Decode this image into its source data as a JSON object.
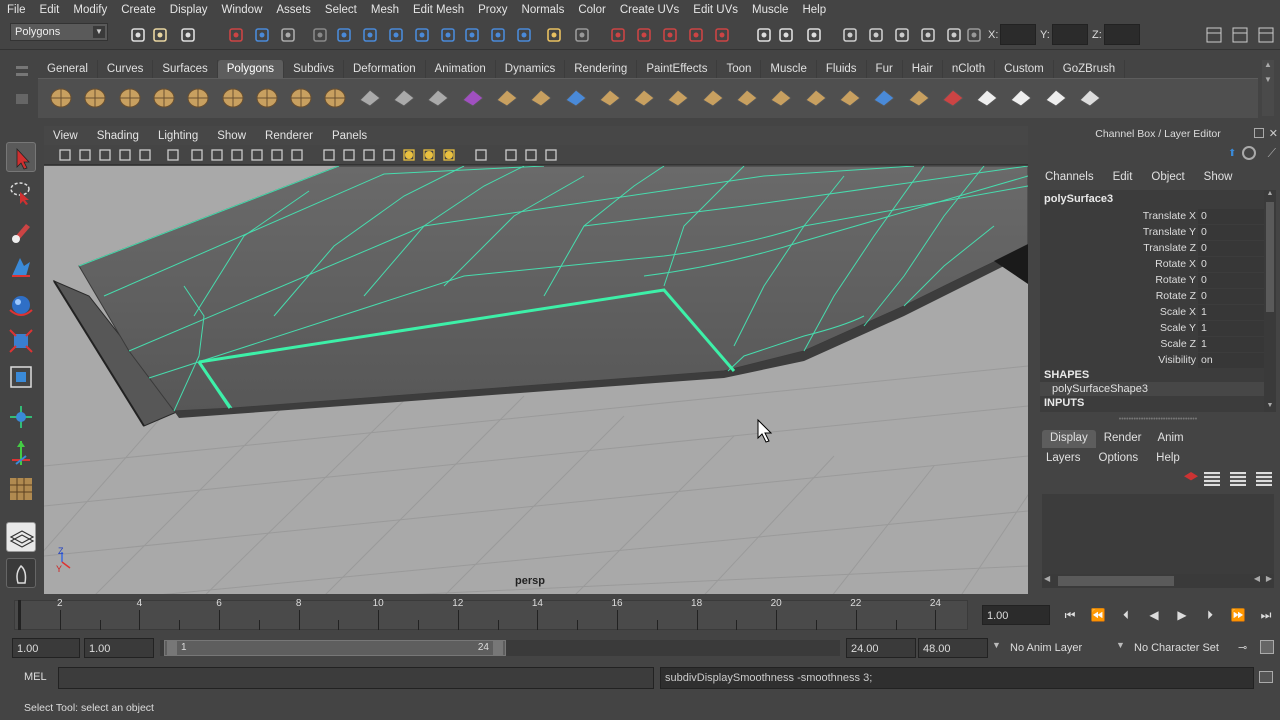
{
  "menubar": [
    "File",
    "Edit",
    "Modify",
    "Create",
    "Display",
    "Window",
    "Assets",
    "Select",
    "Mesh",
    "Edit Mesh",
    "Proxy",
    "Normals",
    "Color",
    "Create UVs",
    "Edit UVs",
    "Muscle",
    "Help"
  ],
  "status": {
    "mode_selector": "Polygons",
    "x_label": "X:",
    "y_label": "Y:",
    "z_label": "Z:"
  },
  "shelf_tabs": [
    "General",
    "Curves",
    "Surfaces",
    "Polygons",
    "Subdivs",
    "Deformation",
    "Animation",
    "Dynamics",
    "Rendering",
    "PaintEffects",
    "Toon",
    "Muscle",
    "Fluids",
    "Fur",
    "Hair",
    "nCloth",
    "Custom",
    "GoZBrush"
  ],
  "active_shelf_tab": "Polygons",
  "viewport": {
    "menus": [
      "View",
      "Shading",
      "Lighting",
      "Show",
      "Renderer",
      "Panels"
    ],
    "camera_label": "persp",
    "axis_y": "Y",
    "axis_z": "Z"
  },
  "channel_box": {
    "title": "Channel Box / Layer Editor",
    "menus": [
      "Channels",
      "Edit",
      "Object",
      "Show"
    ],
    "object_name": "polySurface3",
    "attributes": [
      {
        "name": "Translate X",
        "value": "0"
      },
      {
        "name": "Translate Y",
        "value": "0"
      },
      {
        "name": "Translate Z",
        "value": "0"
      },
      {
        "name": "Rotate X",
        "value": "0"
      },
      {
        "name": "Rotate Y",
        "value": "0"
      },
      {
        "name": "Rotate Z",
        "value": "0"
      },
      {
        "name": "Scale X",
        "value": "1"
      },
      {
        "name": "Scale Y",
        "value": "1"
      },
      {
        "name": "Scale Z",
        "value": "1"
      },
      {
        "name": "Visibility",
        "value": "on"
      }
    ],
    "shapes_header": "SHAPES",
    "shape_name": "polySurfaceShape3",
    "inputs_header": "INPUTS"
  },
  "layer_editor": {
    "tabs": [
      "Display",
      "Render",
      "Anim"
    ],
    "active_tab": "Display",
    "menus": [
      "Layers",
      "Options",
      "Help"
    ]
  },
  "timeline": {
    "ticks": [
      "2",
      "4",
      "6",
      "8",
      "10",
      "12",
      "14",
      "16",
      "18",
      "20",
      "22",
      "24"
    ],
    "current_frame": "1.00"
  },
  "range": {
    "start_time": "1.00",
    "playback_start": "1.00",
    "slider_start": "1",
    "slider_end": "24",
    "playback_end": "24.00",
    "end_time": "48.00",
    "anim_layer": "No Anim Layer",
    "character_set": "No Character Set"
  },
  "command": {
    "label": "MEL",
    "input_value": "",
    "result": "subdivDisplaySmoothness -smoothness 3;"
  },
  "help_line": "Select Tool: select an object",
  "colors": {
    "accent_green": "#3df0a8",
    "viewport_bg": "#a9a9a9",
    "mesh_dark": "#5c5c5c"
  }
}
